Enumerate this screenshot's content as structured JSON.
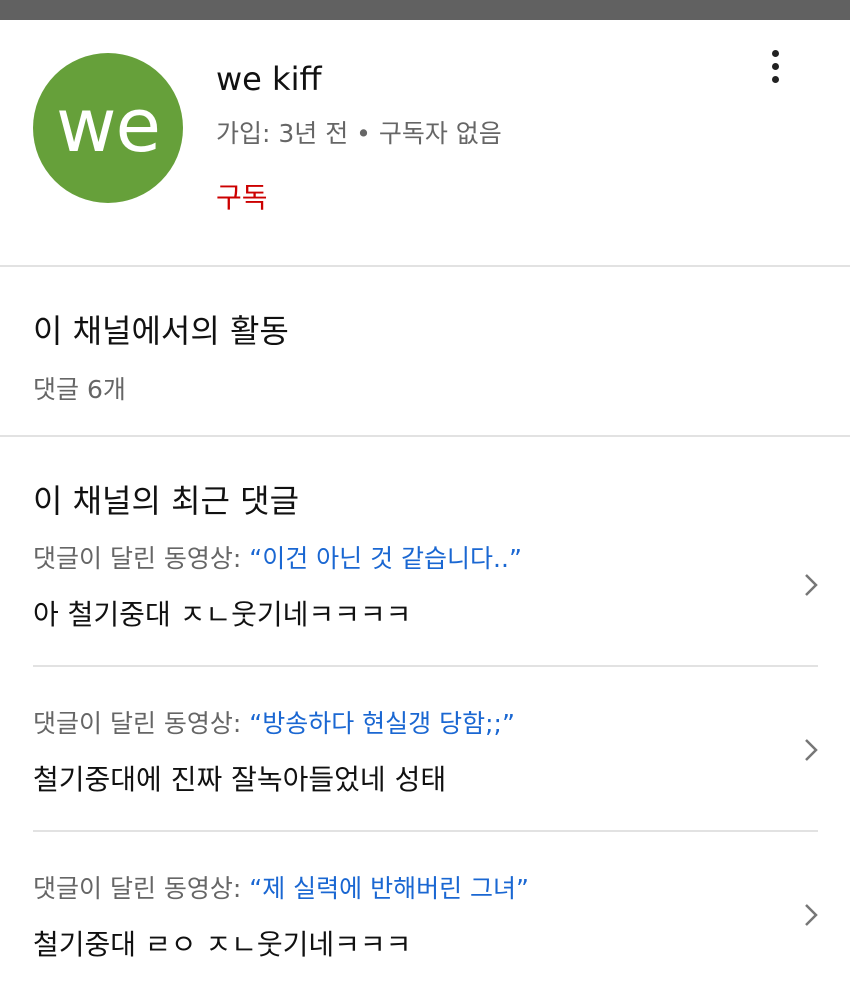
{
  "channel": {
    "avatar_text": "we",
    "avatar_color": "#66a03a",
    "name": "we kiff",
    "meta": "가입: 3년 전 • 구독자 없음",
    "subscribe_label": "구독"
  },
  "activity": {
    "title": "이 채널에서의 활동",
    "count": "댓글 6개"
  },
  "recent": {
    "title": "이 채널의 최근 댓글",
    "comments": [
      {
        "prefix": "댓글이 달린 동영상: ",
        "video": "“이건 아닌 것 같습니다..”",
        "text": "아 철기중대 ㅈㄴ웃기네ㅋㅋㅋㅋ"
      },
      {
        "prefix": "댓글이 달린 동영상: ",
        "video": "“방송하다 현실갱 당함;;”",
        "text": "철기중대에 진짜 잘녹아들었네 성태"
      },
      {
        "prefix": "댓글이 달린 동영상: ",
        "video": "“제 실력에 반해버린 그녀”",
        "text": "철기중대 ㄹㅇ ㅈㄴ웃기네ㅋㅋㅋ"
      }
    ]
  },
  "colors": {
    "subscribe": "#cc0000",
    "link": "#1a67d2",
    "status_bar": "#616161"
  },
  "icons": {
    "menu": "more-vert-icon",
    "row_arrow": "chevron-right-icon"
  }
}
